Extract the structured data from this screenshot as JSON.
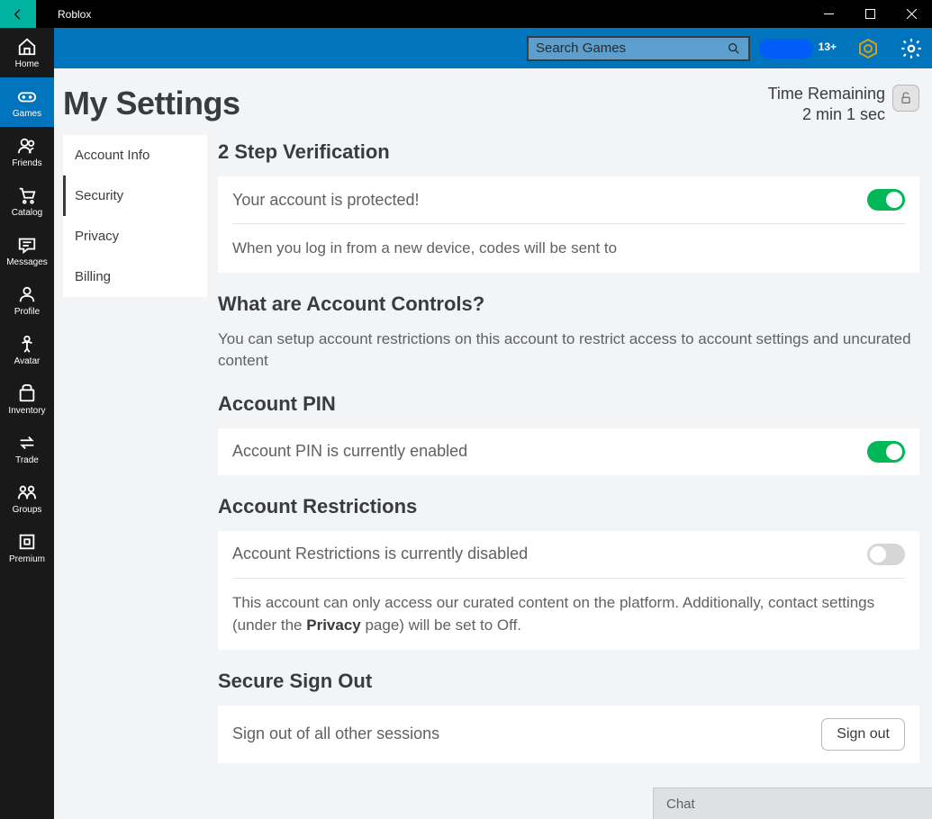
{
  "titlebar": {
    "appName": "Roblox"
  },
  "sidebar": {
    "items": [
      {
        "label": "Home"
      },
      {
        "label": "Games"
      },
      {
        "label": "Friends"
      },
      {
        "label": "Catalog"
      },
      {
        "label": "Messages"
      },
      {
        "label": "Profile"
      },
      {
        "label": "Avatar"
      },
      {
        "label": "Inventory"
      },
      {
        "label": "Trade"
      },
      {
        "label": "Groups"
      },
      {
        "label": "Premium"
      }
    ]
  },
  "topbar": {
    "searchPlaceholder": "Search Games",
    "ageLabel": "13+"
  },
  "page": {
    "title": "My Settings",
    "timeRemaining": {
      "label": "Time Remaining",
      "value": "2 min 1 sec"
    }
  },
  "tabs": {
    "items": [
      {
        "label": "Account Info"
      },
      {
        "label": "Security"
      },
      {
        "label": "Privacy"
      },
      {
        "label": "Billing"
      }
    ],
    "activeIndex": 1
  },
  "sections": {
    "twoStep": {
      "title": "2 Step Verification",
      "enabledText": "Your account is protected!",
      "note": "When you log in from a new device, codes will be sent to",
      "on": true
    },
    "controlsIntro": {
      "title": "What are Account Controls?",
      "desc": "You can setup account restrictions on this account to restrict access to account settings and uncurated content"
    },
    "pin": {
      "title": "Account PIN",
      "text": "Account PIN is currently enabled",
      "on": true
    },
    "restrictions": {
      "title": "Account Restrictions",
      "text": "Account Restrictions is currently disabled",
      "noteBefore": "This account can only access our curated content on the platform. Additionally, contact settings (under the ",
      "privacyWord": "Privacy",
      "noteAfter": " page) will be set to Off.",
      "on": false
    },
    "signout": {
      "title": "Secure Sign Out",
      "text": "Sign out of all other sessions",
      "button": "Sign out"
    }
  },
  "chat": {
    "label": "Chat"
  }
}
